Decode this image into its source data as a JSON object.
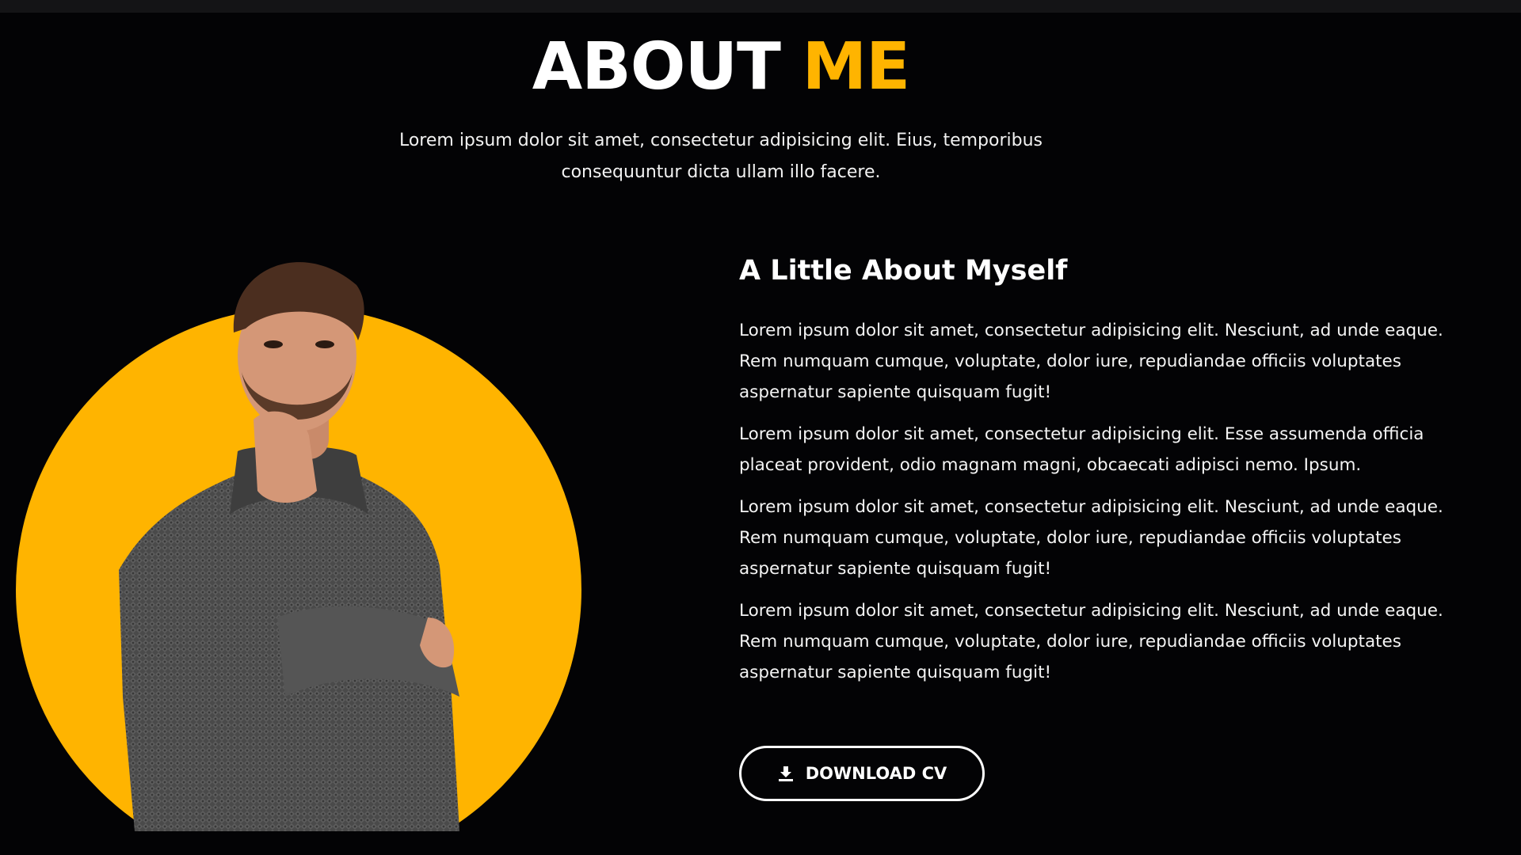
{
  "section": {
    "title_main": "ABOUT",
    "title_accent": "ME",
    "intro": "Lorem ipsum dolor sit amet, consectetur adipisicing elit. Eius, temporibus consequuntur dicta ullam illo facere."
  },
  "about": {
    "heading": "A Little About Myself",
    "paragraphs": [
      "Lorem ipsum dolor sit amet, consectetur adipisicing elit. Nesciunt, ad unde eaque. Rem numquam cumque, voluptate, dolor iure, repudiandae officiis voluptates aspernatur sapiente quisquam fugit!",
      "Lorem ipsum dolor sit amet, consectetur adipisicing elit. Esse assumenda officia placeat provident, odio magnam magni, obcaecati adipisci nemo. Ipsum.",
      "Lorem ipsum dolor sit amet, consectetur adipisicing elit. Nesciunt, ad unde eaque. Rem numquam cumque, voluptate, dolor iure, repudiandae officiis voluptates aspernatur sapiente quisquam fugit!",
      "Lorem ipsum dolor sit amet, consectetur adipisicing elit. Nesciunt, ad unde eaque. Rem numquam cumque, voluptate, dolor iure, repudiandae officiis voluptates aspernatur sapiente quisquam fugit!"
    ]
  },
  "cta": {
    "download_label": "DOWNLOAD CV",
    "icon": "download-icon"
  },
  "colors": {
    "background": "#030305",
    "accent": "#ffb400",
    "text": "#ffffff"
  }
}
